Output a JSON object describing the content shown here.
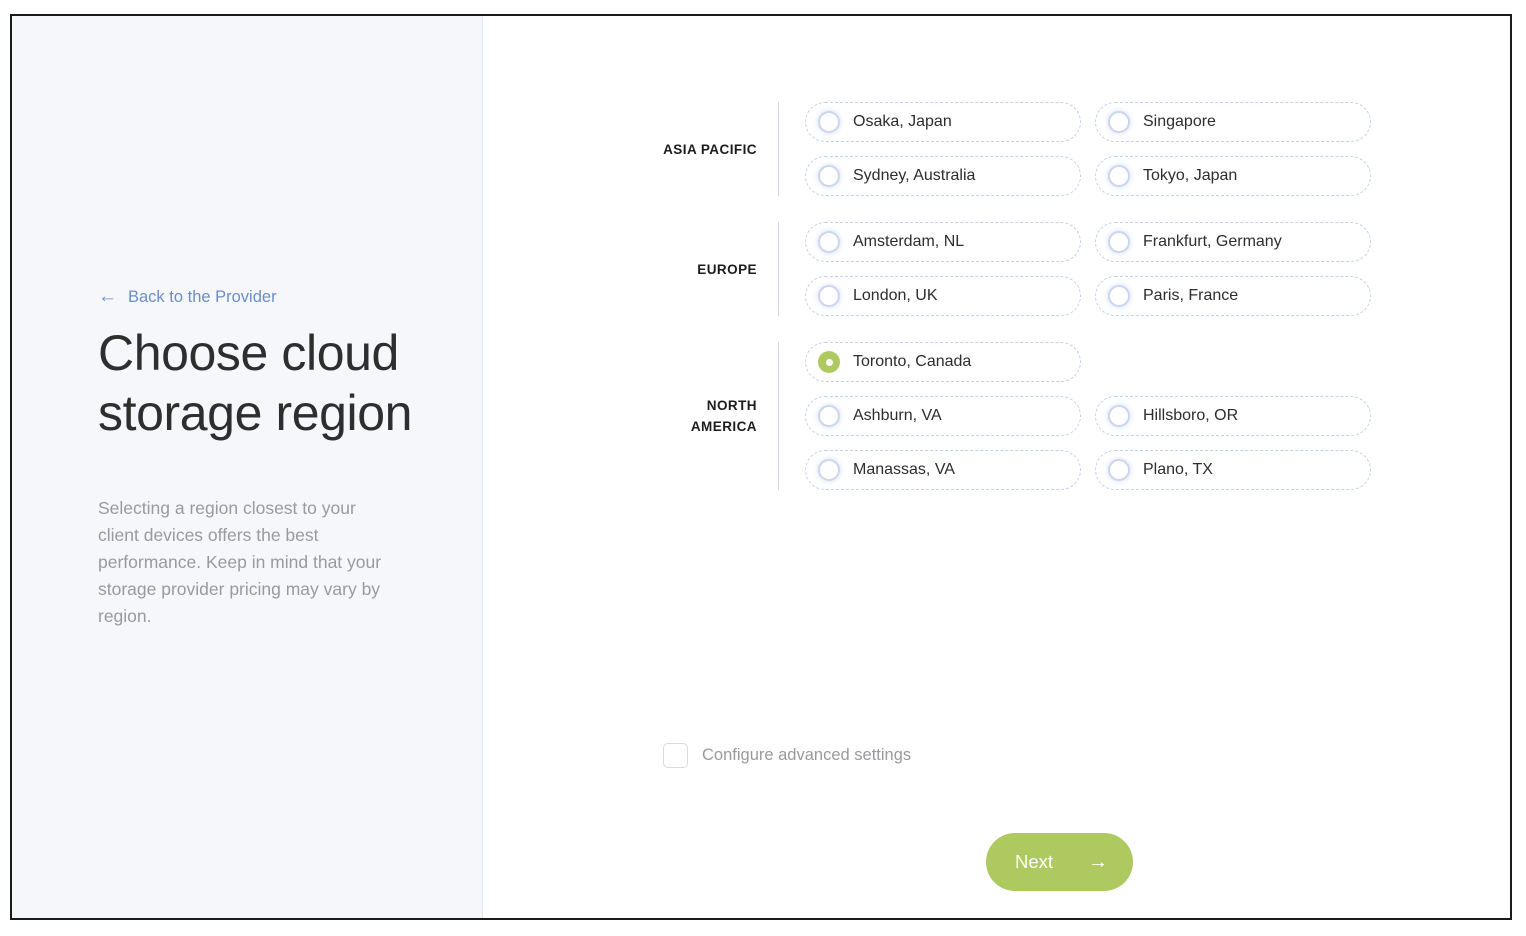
{
  "sidebar": {
    "back_link": {
      "label": "Back to the Provider",
      "icon": "arrow-left-icon",
      "glyph": "←",
      "color": "#6b8ec7"
    },
    "title": "Choose cloud\nstorage region",
    "description": "Selecting a region closest to your client devices offers the best performance. Keep in mind that your storage provider pricing may vary by region.",
    "background_color": "#f6f7fb"
  },
  "main": {
    "region_groups": [
      {
        "label": "ASIA PACIFIC",
        "rows": [
          [
            {
              "label": "Osaka, Japan",
              "selected": false
            },
            {
              "label": "Singapore",
              "selected": false
            }
          ],
          [
            {
              "label": "Sydney, Australia",
              "selected": false
            },
            {
              "label": "Tokyo, Japan",
              "selected": false
            }
          ]
        ]
      },
      {
        "label": "EUROPE",
        "rows": [
          [
            {
              "label": "Amsterdam, NL",
              "selected": false
            },
            {
              "label": "Frankfurt, Germany",
              "selected": false
            }
          ],
          [
            {
              "label": "London, UK",
              "selected": false
            },
            {
              "label": "Paris, France",
              "selected": false
            }
          ]
        ]
      },
      {
        "label": "NORTH\nAMERICA",
        "rows": [
          [
            {
              "label": "Toronto, Canada",
              "selected": true
            }
          ],
          [
            {
              "label": "Ashburn, VA",
              "selected": false
            },
            {
              "label": "Hillsboro, OR",
              "selected": false
            }
          ],
          [
            {
              "label": "Manassas, VA",
              "selected": false
            },
            {
              "label": "Plano, TX",
              "selected": false
            }
          ]
        ]
      }
    ],
    "advanced_settings": {
      "label": "Configure advanced settings",
      "checked": false
    },
    "next_button": {
      "label": "Next",
      "icon": "arrow-right-icon",
      "glyph": "→",
      "color": "#aec960"
    }
  },
  "colors": {
    "accent_green": "#aec960",
    "link_blue": "#6b8ec7",
    "pill_border": "#c3d2ef",
    "radio_ring": "#cbd6ef",
    "sidebar_bg": "#f6f7fb",
    "muted_text": "#9a9a9e"
  }
}
